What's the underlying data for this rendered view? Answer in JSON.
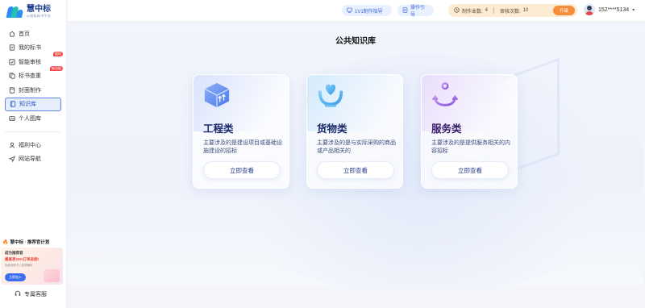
{
  "app": {
    "logo_title": "慧中标",
    "logo_sub": "AI投标标书平台"
  },
  "sidebar": {
    "items": [
      {
        "label": "首页",
        "icon": "home-icon"
      },
      {
        "label": "我的标书",
        "icon": "document-icon"
      },
      {
        "label": "智能审核",
        "icon": "audit-icon",
        "badge": "限时"
      },
      {
        "label": "标书查重",
        "icon": "duplicate-check-icon",
        "badge": "新功能"
      },
      {
        "label": "封面制作",
        "icon": "cover-icon"
      },
      {
        "label": "知识库",
        "icon": "book-icon",
        "active": true
      },
      {
        "label": "个人图库",
        "icon": "image-icon"
      }
    ],
    "secondary": [
      {
        "label": "福利中心",
        "icon": "user-icon"
      },
      {
        "label": "网站导航",
        "icon": "send-icon"
      }
    ],
    "promo": {
      "header": "慧中标 · 推荐官计划",
      "line1": "成为推荐官",
      "line2": "最高享25%订单返佣!",
      "line3": "免费领标书 | 金领福利",
      "button": "立即加入"
    },
    "service_label": "专属客服"
  },
  "topbar": {
    "btn_guide": "1V1制作指导",
    "btn_manual": "操作引导",
    "quota_make_label": "制作本数:",
    "quota_make_value": "4",
    "quota_audit_label": "审核次数:",
    "quota_audit_value": "10",
    "upgrade_label": "升级",
    "user_phone": "152****5134"
  },
  "main": {
    "title": "公共知识库",
    "cards": [
      {
        "title": "工程类",
        "desc": "主要涉及的是建设项目或基础设施建设的招标",
        "button": "立即查看",
        "icon": "engineering-box-icon"
      },
      {
        "title": "货物类",
        "desc": "主要涉及的是与实际采购的商品或产品相关的",
        "button": "立即查看",
        "icon": "goods-heart-hand-icon"
      },
      {
        "title": "服务类",
        "desc": "主要涉及的是提供服务相关的内容招标",
        "button": "立即查看",
        "icon": "service-anchor-icon"
      }
    ]
  },
  "colors": {
    "accent": "#3a67d8",
    "active_border": "#5b84e8",
    "upgrade": "#f58d3c",
    "badge": "#f04b4b"
  }
}
